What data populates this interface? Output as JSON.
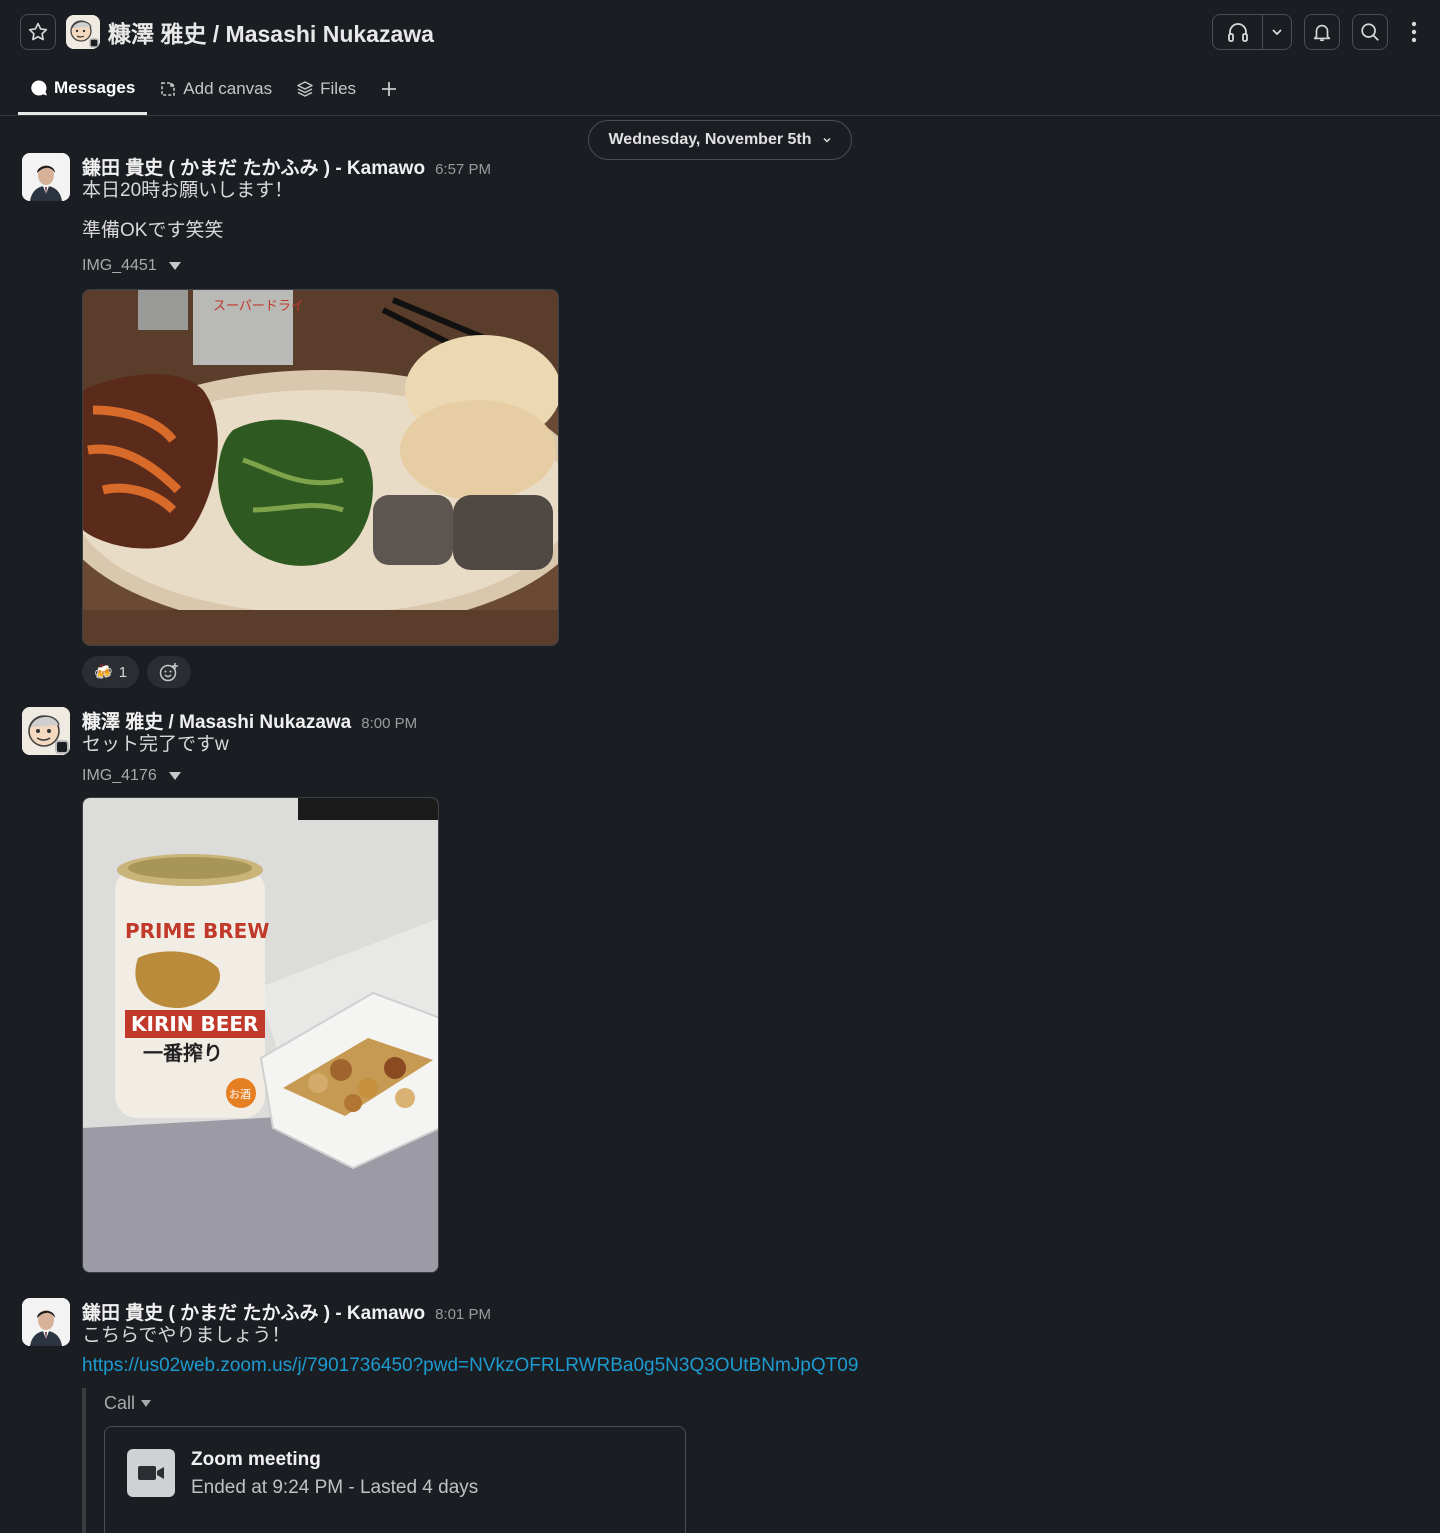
{
  "header": {
    "title": "糠澤 雅史 / Masashi Nukazawa",
    "icons": [
      "star-icon",
      "headphones-icon",
      "chevron-down-icon",
      "bell-icon",
      "search-icon",
      "kebab-icon"
    ]
  },
  "tabs": [
    {
      "label": "Messages",
      "icon": "message-bubble-icon"
    },
    {
      "label": "Add canvas",
      "icon": "canvas-icon"
    },
    {
      "label": "Files",
      "icon": "files-icon"
    }
  ],
  "date_divider": {
    "label": "Wednesday, November 5th"
  },
  "messages": [
    {
      "author": "鎌田 貴史 ( かまだ たかふみ ) - Kamawo",
      "time": "6:57 PM",
      "lines": [
        "本日20時お願いします！",
        "準備OKです笑笑"
      ],
      "file": {
        "name": "IMG_4451",
        "image_text": "スーパードライ"
      },
      "reactions": [
        {
          "emoji": "🍻",
          "count": "1"
        }
      ]
    },
    {
      "author": "糠澤 雅史 / Masashi Nukazawa",
      "time": "8:00 PM",
      "lines": [
        "セット完了ですw"
      ],
      "file": {
        "name": "IMG_4176",
        "image_text": [
          "PRIME BREW",
          "KIRIN BEER",
          "一番搾り",
          "お酒"
        ]
      }
    },
    {
      "author": "鎌田 貴史 ( かまだ たかふみ ) - Kamawo",
      "time": "8:01 PM",
      "lines": [
        "こちらでやりましょう！"
      ],
      "link": "https://us02web.zoom.us/j/7901736450?pwd=NVkzOFRLRWRBa0g5N3Q3OUtBNmJpQT09",
      "call": {
        "label": "Call",
        "title": "Zoom meeting",
        "subtitle": "Ended at 9:24 PM - Lasted 4 days"
      }
    }
  ],
  "colors": {
    "background": "#1a1d21",
    "link": "#1d9bd1",
    "border": "#4a4d52"
  }
}
